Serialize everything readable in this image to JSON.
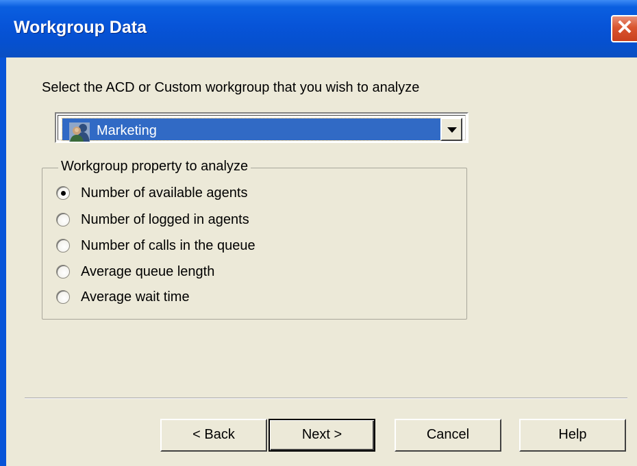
{
  "window": {
    "title": "Workgroup Data",
    "close_symbol": "✕"
  },
  "prompt": "Select the ACD or Custom workgroup that you wish to analyze",
  "workgroup_select": {
    "icon": "workgroup-people-icon",
    "value": "Marketing"
  },
  "property_group": {
    "legend": "Workgroup property to analyze",
    "options": [
      {
        "label": "Number of available agents",
        "selected": true
      },
      {
        "label": "Number of logged in agents",
        "selected": false
      },
      {
        "label": "Number of calls in the queue",
        "selected": false
      },
      {
        "label": "Average queue length",
        "selected": false
      },
      {
        "label": "Average wait time",
        "selected": false
      }
    ]
  },
  "buttons": {
    "back": "< Back",
    "next": "Next >",
    "cancel": "Cancel",
    "help": "Help"
  },
  "colors": {
    "title_bar": "#0754d8",
    "selection": "#316ac5",
    "dialog_bg": "#ece9d8",
    "close_button": "#d9552f"
  }
}
